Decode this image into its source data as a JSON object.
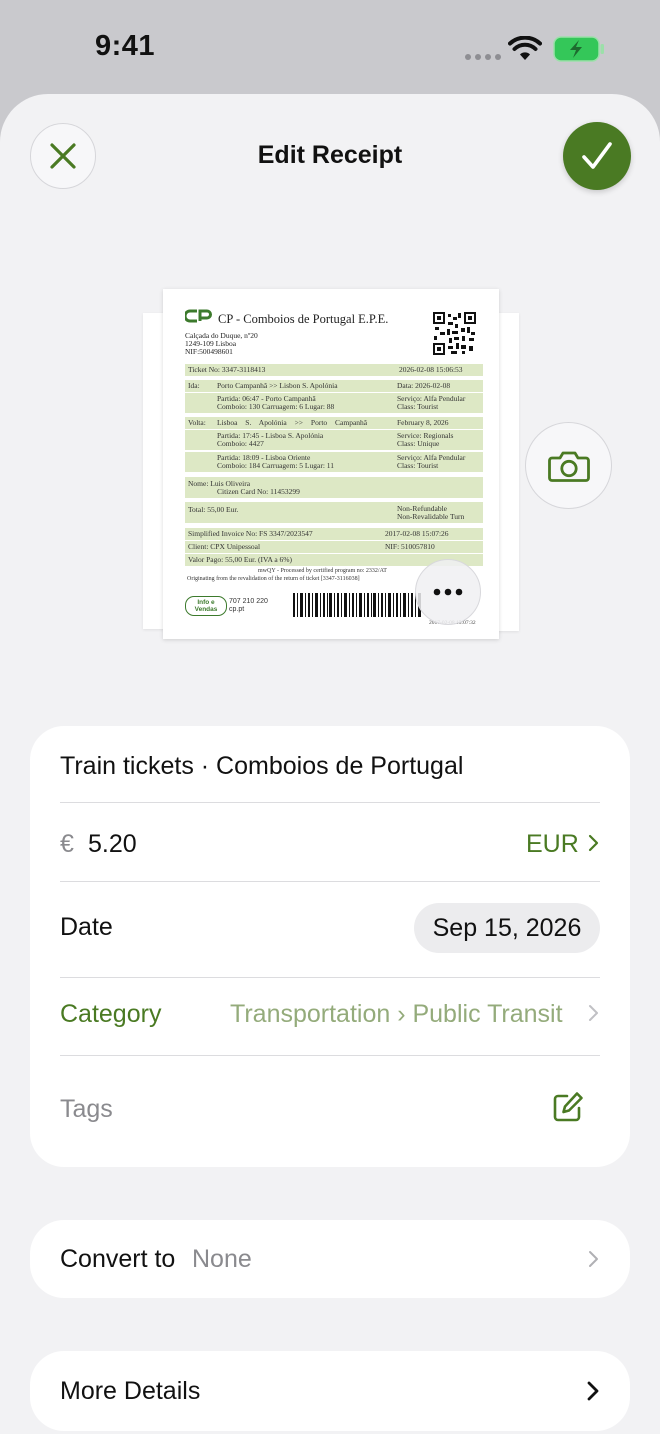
{
  "status_bar": {
    "time": "9:41"
  },
  "header": {
    "title": "Edit Receipt"
  },
  "receipt": {
    "company": "CP - Comboios de Portugal E.P.E.",
    "address_lines": [
      "Calçada do Duque, nº20",
      "1249-109 Lisboa",
      "NIF:500498601"
    ],
    "ticket_no": "Ticket No: 3347-3118413",
    "ticket_datetime": "2026-02-08 15:06:53",
    "ida_label": "Ida:",
    "ida_route": "Porto Campanhã >> Lisbon S. Apolónia",
    "ida_date": "Data: 2026-02-08",
    "ida_partida": "Partida: 06:47 - Porto Campanhã",
    "ida_comboio": "Comboio: 130 Carruagem: 6 Lugar: 88",
    "ida_servico": "Serviço: Alfa Pendular",
    "ida_class": "Class: Tourist",
    "volta_label": "Volta:",
    "volta_route": "Lisboa S. Apolónia >> Porto Campanhã",
    "volta_date": "February 8, 2026",
    "volta1_partida": "Partida: 17:45 - Lisboa S. Apolónia",
    "volta1_comboio": "Comboio: 4427",
    "volta1_servico": "Service: Regionals",
    "volta1_class": "Class: Unique",
    "volta2_partida": "Partida: 18:09 - Lisboa Oriente",
    "volta2_comboio": "Comboio: 184 Carruagem: 5 Lugar: 11",
    "volta2_servico": "Serviço: Alfa Pendular",
    "volta2_class": "Class: Tourist",
    "name_line": "Nome: Luis Oliveira",
    "citizen_card": "Citizen Card No: 11453299",
    "total": "Total: 55,00 Eur.",
    "non_refundable": "Non-Refundable",
    "non_revalidable": "Non-Revalidable Turn",
    "invoice": "Simplified Invoice No: FS 3347/2023547",
    "invoice_datetime": "2017-02-08 15:07:26",
    "client": "Client: CPX Unipessoal",
    "nif": "NIF: 510057810",
    "valor_pago": "Valor Pago: 55,00 Eur. (IVA a 6%)",
    "processed_by": "mwQY - Processed by certified program no: 2332/AT",
    "originating": "Originating from the revalidation of the return of ticket [3347-3116038]",
    "info_box": "Info e Vendas",
    "phone": "707 210 220",
    "site": "cp.pt",
    "stamp": "2017-02-08 15:07:32"
  },
  "form": {
    "title": "Train tickets · Comboios de Portugal",
    "currency_symbol": "€",
    "amount": "5.20",
    "currency_code": "EUR",
    "date_label": "Date",
    "date_value": "Sep 15, 2026",
    "category_label": "Category",
    "category_value": "Transportation › Public Transit",
    "tags_label": "Tags"
  },
  "convert": {
    "label": "Convert to",
    "value": "None"
  },
  "more_details": {
    "label": "More Details"
  },
  "colors": {
    "accent": "#4a7a23",
    "background": "#f2f2f4",
    "receipt_band": "#dde8c5"
  },
  "icons": [
    "close-icon",
    "checkmark-icon",
    "camera-icon",
    "ellipsis-icon",
    "chevron-right-icon",
    "edit-icon",
    "wifi-icon",
    "battery-icon"
  ]
}
